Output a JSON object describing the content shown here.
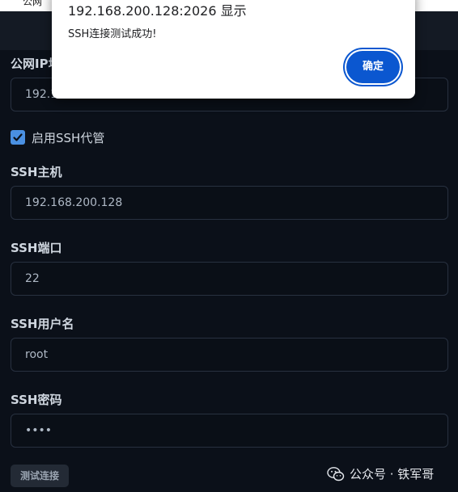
{
  "dialog": {
    "title": "192.168.200.128:2026 显示",
    "message": "SSH连接测试成功!",
    "ok_label": "确定"
  },
  "background_fragment": "公网",
  "form": {
    "public_ip": {
      "label": "公网IP地",
      "value": "192.1"
    },
    "ssh_proxy": {
      "label": "启用SSH代管",
      "checked": true
    },
    "ssh_host": {
      "label": "SSH主机",
      "value": "192.168.200.128"
    },
    "ssh_port": {
      "label": "SSH端口",
      "value": "22"
    },
    "ssh_user": {
      "label": "SSH用户名",
      "value": "root"
    },
    "ssh_password": {
      "label": "SSH密码",
      "value": "••••"
    },
    "test_button_label": "测试连接"
  },
  "watermark": {
    "text": "公众号 · 铁军哥",
    "icon": "wechat-icon"
  },
  "colors": {
    "background": "#0b1019",
    "input_border": "#283140",
    "checkbox": "#4a90e2",
    "dialog_button": "#0b57d0"
  }
}
